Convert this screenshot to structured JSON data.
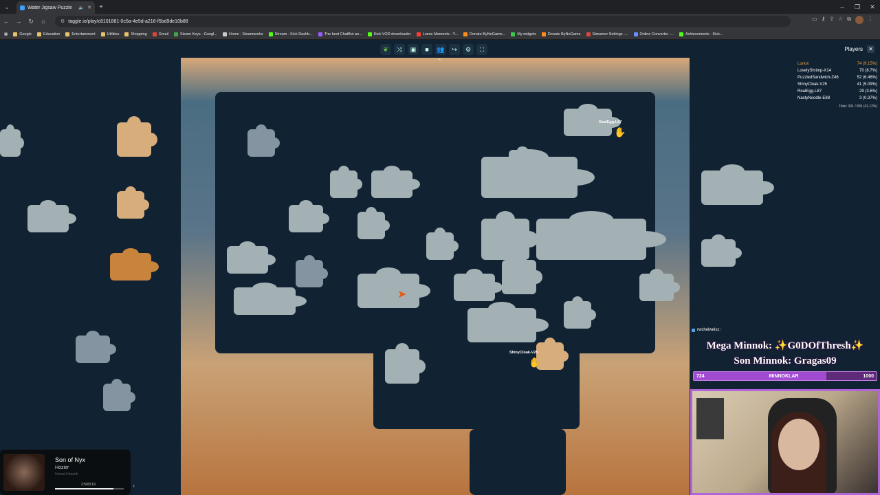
{
  "browser": {
    "tab_title": "Water Jigsaw Puzzle",
    "url": "taggle.io/play/c8101881-0c5a-4e5d-a216-f5bd9de10b88",
    "bookmarks": [
      "Google",
      "Education",
      "Entertainment",
      "Utilities",
      "Shopping",
      "Gmail",
      "Steam Keys - Googl...",
      "Home - Steamworks",
      "Stream - Kick Dashb...",
      "The best ChatBot an...",
      "Kick VOD downloader",
      "Lunox Moments - Y...",
      "Donate ByNoGame...",
      "My widgets",
      "Donate ByNoGame",
      "Streamer Settings -...",
      "Online Converter -...",
      "Achievements - Kick..."
    ]
  },
  "players": {
    "header": "Players",
    "list": [
      {
        "name": "Lunox",
        "score": "74 (9.15%)"
      },
      {
        "name": "LovelyShrimp-X14",
        "score": "70 (8.7%)"
      },
      {
        "name": "PuzzledSandwich-Z46",
        "score": "52 (6.46%)"
      },
      {
        "name": "ShinyCloak-V25",
        "score": "41 (5.09%)"
      },
      {
        "name": "RealEgg-L87",
        "score": "29 (3.6%)"
      },
      {
        "name": "NastyNoodle-E88",
        "score": "3 (0.37%)"
      }
    ],
    "total": "Total: 331 / 805 (41.12%)"
  },
  "cursors": {
    "realegg": "RealEgg-L87",
    "shinycloak": "ShinyCloak-V25"
  },
  "stream": {
    "chat_user": "rwchelwelsz :",
    "mega_minnok": "Mega Minnok: ✨G0DOfThresh✨",
    "son_minnok": "Son Minnok: Gragas09",
    "bar_label": "MINNOKLAR",
    "bar_current": "724",
    "bar_max": "1000",
    "bar_fraction": 0.724
  },
  "music": {
    "title": "Son of Nyx",
    "artist": "Hozier",
    "album": "Unreal Unearth",
    "time": "2:50/3:19",
    "progress": 0.85
  },
  "icons": {
    "back": "arrow-left",
    "forward": "arrow-right",
    "reload": "reload",
    "home": "home"
  }
}
